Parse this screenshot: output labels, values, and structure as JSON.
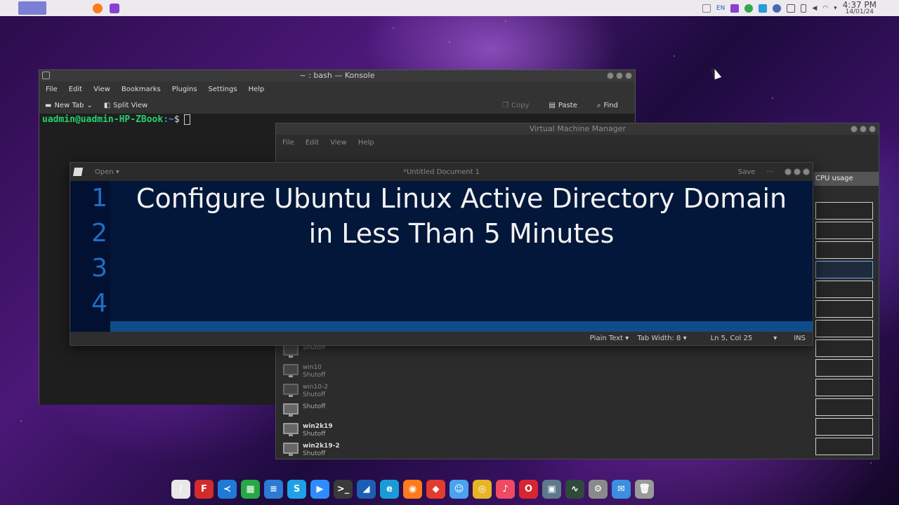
{
  "top_panel": {
    "tray": {
      "lang": "EN"
    },
    "clock": {
      "time": "4:37 PM",
      "date": "14/01/24"
    }
  },
  "konsole": {
    "title": "~ : bash — Konsole",
    "menu": [
      "File",
      "Edit",
      "View",
      "Bookmarks",
      "Plugins",
      "Settings",
      "Help"
    ],
    "toolbar": {
      "new_tab": "New Tab",
      "split_view": "Split View",
      "copy": "Copy",
      "paste": "Paste",
      "find": "Find"
    },
    "prompt": {
      "user_host": "uadmin@uadmin-HP-ZBook",
      "path": ":~",
      "symbol": "$"
    }
  },
  "vmm": {
    "title": "Virtual Machine Manager",
    "menu": [
      "File",
      "Edit",
      "View",
      "Help"
    ],
    "cpu_header": "CPU usage",
    "vms": [
      {
        "name": "",
        "state": "Shutoff",
        "faded": true
      },
      {
        "name": "win10",
        "state": "Shutoff",
        "faded": true
      },
      {
        "name": "win10-2",
        "state": "Shutoff",
        "faded": true
      },
      {
        "name": "",
        "state": "Shutoff",
        "faded": false
      },
      {
        "name": "win2k19",
        "state": "Shutoff",
        "faded": false
      },
      {
        "name": "win2k19-2",
        "state": "Shutoff",
        "faded": false
      }
    ]
  },
  "gedit": {
    "open": "Open",
    "title": "*Untitled Document 1",
    "save": "Save",
    "more": "···",
    "line_numbers": [
      "1",
      "2",
      "3",
      "4"
    ],
    "lines": [
      "Configure Ubuntu Linux Active Directory Domain",
      "in Less Than 5 Minutes"
    ],
    "status": {
      "language": "Plain Text",
      "tab_width": "Tab Width: 8",
      "position": "Ln 5, Col 25",
      "mode": "INS"
    }
  },
  "dock": {
    "icons": [
      {
        "name": "text-editor-icon",
        "color": "#e8e8e8",
        "glyph": "/"
      },
      {
        "name": "filezilla-icon",
        "color": "#d22b2b",
        "glyph": "F"
      },
      {
        "name": "vscode-icon",
        "color": "#1f7ad6",
        "glyph": "≺"
      },
      {
        "name": "spreadsheet-icon",
        "color": "#27a844",
        "glyph": "▦"
      },
      {
        "name": "document-icon",
        "color": "#2a7ad6",
        "glyph": "≡"
      },
      {
        "name": "skype-icon",
        "color": "#1fa0e8",
        "glyph": "S"
      },
      {
        "name": "zoom-icon",
        "color": "#2d8cff",
        "glyph": "▶"
      },
      {
        "name": "terminal-icon",
        "color": "#3a3a3a",
        "glyph": ">_"
      },
      {
        "name": "shark-icon",
        "color": "#1a5fb4",
        "glyph": "◢"
      },
      {
        "name": "edge-icon",
        "color": "#1a9bd8",
        "glyph": "e"
      },
      {
        "name": "firefox-icon",
        "color": "#ff7a1a",
        "glyph": "◉"
      },
      {
        "name": "anydesk-icon",
        "color": "#e33b2e",
        "glyph": "◆"
      },
      {
        "name": "finder-icon",
        "color": "#4aa2f0",
        "glyph": "☺"
      },
      {
        "name": "chrome-icon",
        "color": "#e7b426",
        "glyph": "◎"
      },
      {
        "name": "music-icon",
        "color": "#f04a62",
        "glyph": "♪"
      },
      {
        "name": "opera-icon",
        "color": "#d9252f",
        "glyph": "O"
      },
      {
        "name": "screenshot-icon",
        "color": "#5c7a8a",
        "glyph": "▣"
      },
      {
        "name": "system-monitor-icon",
        "color": "#2e4a3a",
        "glyph": "∿"
      },
      {
        "name": "settings-icon",
        "color": "#8a8a8a",
        "glyph": "⚙"
      },
      {
        "name": "mail-icon",
        "color": "#3b8ee0",
        "glyph": "✉"
      },
      {
        "name": "trash-icon",
        "color": "#9a9a9a",
        "glyph": "🗑"
      }
    ]
  }
}
